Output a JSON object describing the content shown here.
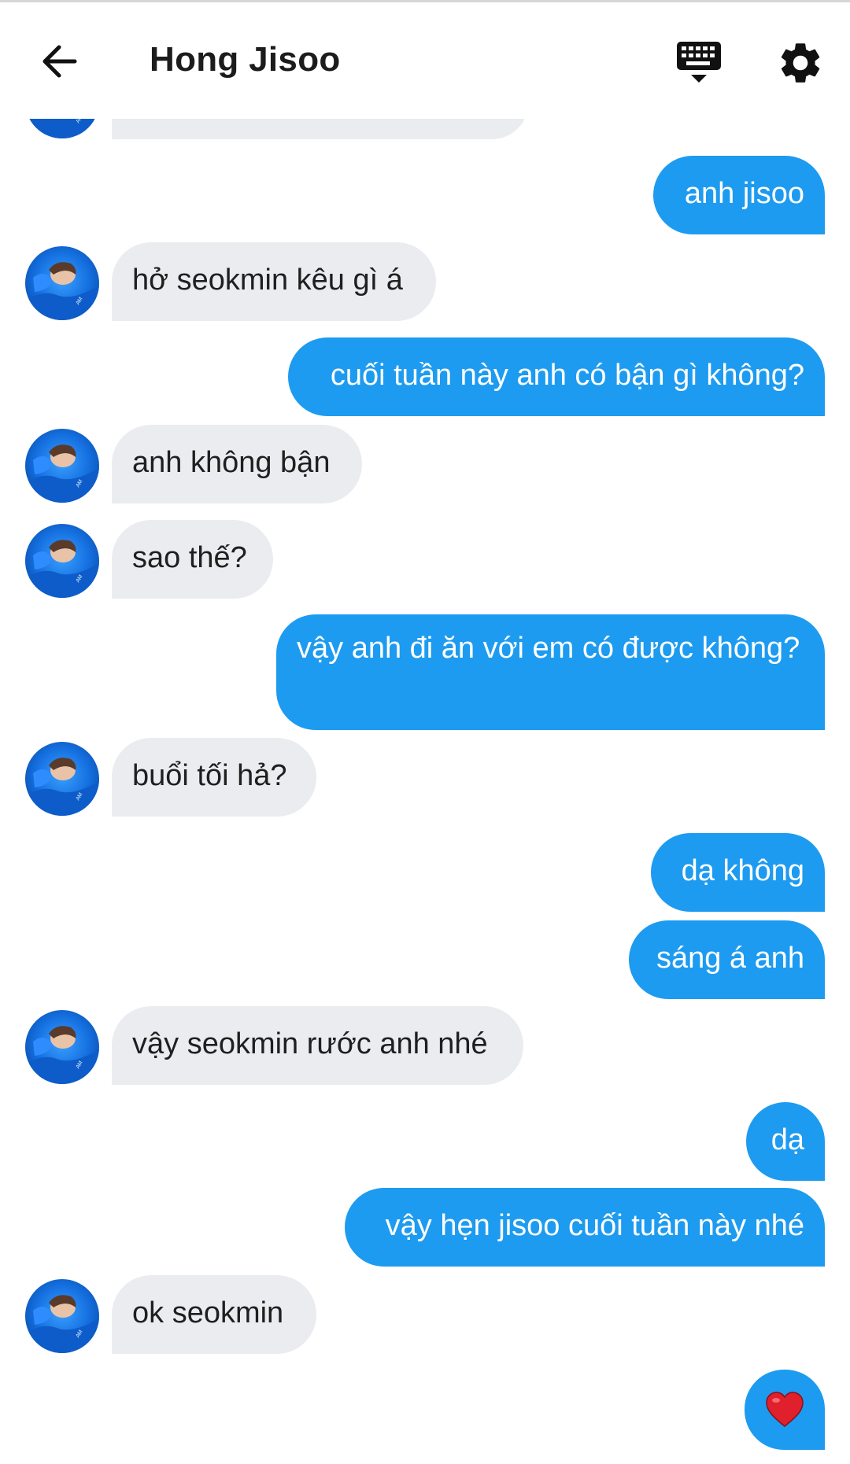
{
  "header": {
    "title": "Hong Jisoo"
  },
  "icons": {
    "back": "arrow-left-icon",
    "keyboard": "keyboard-icon",
    "settings": "gear-icon",
    "heart": "heart-emoji"
  },
  "colors": {
    "outgoing": "#1d9bf0",
    "incoming": "#eaecef",
    "heart": "#e0202c"
  },
  "messages": [
    {
      "from": "them",
      "text": ""
    },
    {
      "from": "me",
      "text": "anh jisoo"
    },
    {
      "from": "them",
      "text": "hở seokmin kêu gì á"
    },
    {
      "from": "me",
      "text": "cuối tuần này anh có bận gì không?"
    },
    {
      "from": "them",
      "text": "anh không bận"
    },
    {
      "from": "them",
      "text": "sao thế?"
    },
    {
      "from": "me",
      "text": "vậy anh đi ăn với em có được không?"
    },
    {
      "from": "them",
      "text": "buổi tối hả?"
    },
    {
      "from": "me",
      "text": "dạ không"
    },
    {
      "from": "me",
      "text": "sáng á anh"
    },
    {
      "from": "them",
      "text": "vậy seokmin rước anh nhé"
    },
    {
      "from": "me",
      "text": "dạ"
    },
    {
      "from": "me",
      "text": "vậy hẹn jisoo cuối tuần này nhé"
    },
    {
      "from": "them",
      "text": "ok seokmin"
    },
    {
      "from": "me",
      "text": "❤️"
    }
  ]
}
